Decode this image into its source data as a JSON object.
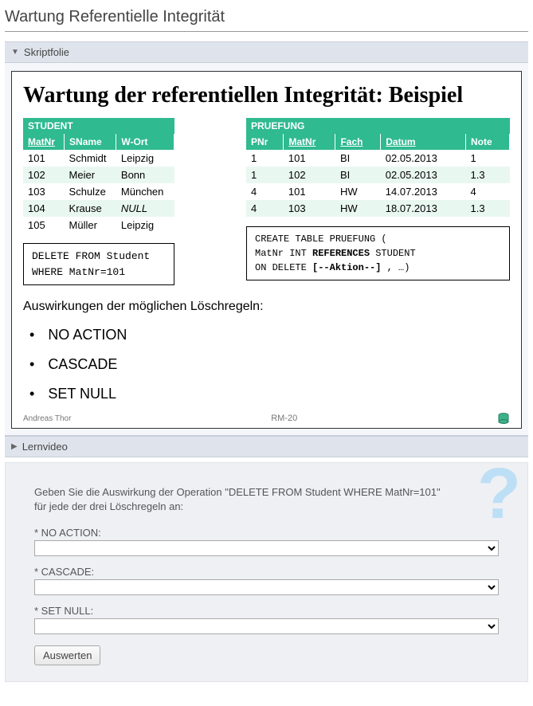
{
  "page": {
    "title": "Wartung Referentielle Integrität"
  },
  "panel_slide": {
    "label": "Skriptfolie"
  },
  "panel_video": {
    "label": "Lernvideo"
  },
  "slide": {
    "title": "Wartung der referentiellen Integrität: Beispiel",
    "student": {
      "caption": "STUDENT",
      "head": [
        "MatNr",
        "SName",
        "W-Ort"
      ],
      "rows": [
        [
          "101",
          "Schmidt",
          "Leipzig"
        ],
        [
          "102",
          "Meier",
          "Bonn"
        ],
        [
          "103",
          "Schulze",
          "München"
        ],
        [
          "104",
          "Krause",
          "NULL"
        ],
        [
          "105",
          "Müller",
          "Leipzig"
        ]
      ]
    },
    "pruefung": {
      "caption": "PRUEFUNG",
      "head": [
        "PNr",
        "MatNr",
        "Fach",
        "Datum",
        "Note"
      ],
      "rows": [
        [
          "1",
          "101",
          "BI",
          "02.05.2013",
          "1"
        ],
        [
          "1",
          "102",
          "BI",
          "02.05.2013",
          "1.3"
        ],
        [
          "4",
          "101",
          "HW",
          "14.07.2013",
          "4"
        ],
        [
          "4",
          "103",
          "HW",
          "18.07.2013",
          "1.3"
        ]
      ]
    },
    "sql_delete": "DELETE FROM Student\nWHERE MatNr=101",
    "sql_create_l1": "CREATE TABLE PRUEFUNG (",
    "sql_create_l2a": "  MatNr INT ",
    "sql_create_l2b": "REFERENCES",
    "sql_create_l2c": " STUDENT",
    "sql_create_l3a": "  ON DELETE ",
    "sql_create_l3b": "[--Aktion--]",
    "sql_create_l3c": " , …)",
    "impact_heading": "Auswirkungen der möglichen Löschregeln:",
    "bullets": [
      "NO ACTION",
      "CASCADE",
      "SET NULL"
    ],
    "footer": {
      "author": "Andreas Thor",
      "page": "RM-20"
    }
  },
  "exercise": {
    "prompt": "Geben Sie die Auswirkung der Operation \"DELETE FROM Student WHERE MatNr=101\" für jede der drei Löschregeln an:",
    "labels": {
      "noaction": "* NO ACTION:",
      "cascade": "* CASCADE:",
      "setnull": "* SET NULL:"
    },
    "button": "Auswerten"
  }
}
